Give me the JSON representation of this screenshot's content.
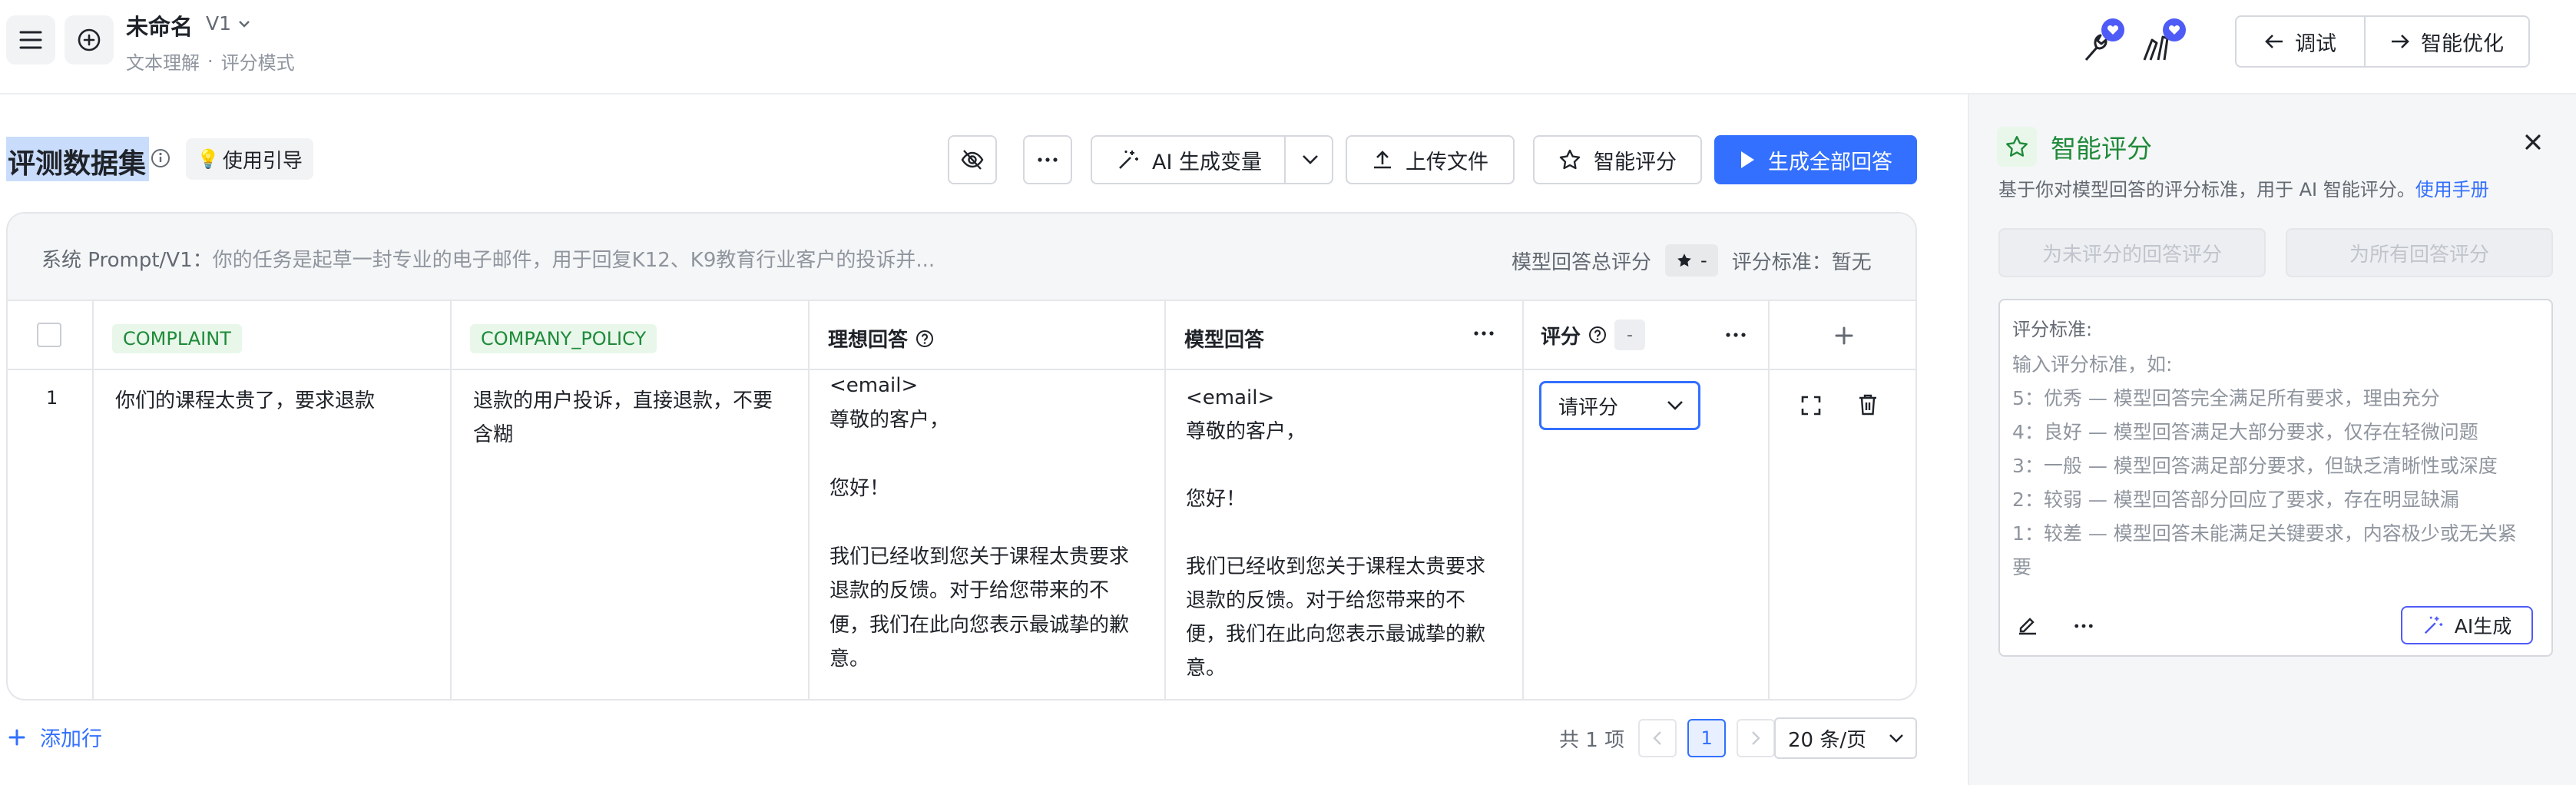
{
  "header": {
    "title": "未命名",
    "version": "V1",
    "breadcrumb": [
      "文本理解",
      "评分模式"
    ],
    "debug_label": "调试",
    "optimize_label": "智能优化"
  },
  "toolbar": {
    "section_title": "评测数据集",
    "guide_label": "使用引导",
    "ai_generate_var_label": "AI 生成变量",
    "upload_label": "上传文件",
    "smart_score_label": "智能评分",
    "generate_all_label": "生成全部回答"
  },
  "table": {
    "system_prompt_label": "系统 Prompt/V1：",
    "system_prompt_value": "你的任务是起草一封专业的电子邮件，用于回复K12、K9教育行业客户的投诉并...",
    "total_score_label": "模型回答总评分",
    "total_score_value": "-",
    "score_standard_label": "评分标准：暂无",
    "columns": {
      "complaint": "COMPLAINT",
      "company_policy": "COMPANY_POLICY",
      "ideal_answer": "理想回答",
      "model_answer": "模型回答",
      "score": "评分",
      "score_dash": "-"
    },
    "rows": [
      {
        "index": "1",
        "complaint": "你们的课程太贵了，要求退款",
        "company_policy": "退款的用户投诉，直接退款，不要\n含糊",
        "ideal_answer": "<email>\n尊敬的客户，\n\n您好！\n\n我们已经收到您关于课程太贵要求\n退款的反馈。对于给您带来的不\n便，我们在此向您表示最诚挚的歉\n意。",
        "model_answer": "<email>\n尊敬的客户，\n\n您好！\n\n我们已经收到您关于课程太贵要求\n退款的反馈。对于给您带来的不\n便，我们在此向您表示最诚挚的歉\n意。",
        "rate_placeholder": "请评分"
      }
    ]
  },
  "footer": {
    "add_row_label": "添加行",
    "total_label": "共 1 项",
    "current_page": "1",
    "page_size": "20 条/页"
  },
  "panel": {
    "title": "智能评分",
    "description": "基于你对模型回答的评分标准，用于 AI 智能评分。",
    "manual_link": "使用手册",
    "btn_unscored": "为未评分的回答评分",
    "btn_all": "为所有回答评分",
    "criteria_label": "评分标准:",
    "criteria_placeholder": "输入评分标准，如:\n5：优秀 — 模型回答完全满足所有要求，理由充分\n4：良好 — 模型回答满足大部分要求，仅存在轻微问题\n3：一般 — 模型回答满足部分要求，但缺乏清晰性或深度\n2：较弱 — 模型回答部分回应了要求，存在明显缺漏\n1：较差 — 模型回答未能满足关键要求，内容极少或无关紧\n要",
    "ai_generate_label": "AI生成"
  },
  "colors": {
    "accent": "#3370ff",
    "green": "#1f8a3a",
    "purple": "#4f5bf6"
  }
}
